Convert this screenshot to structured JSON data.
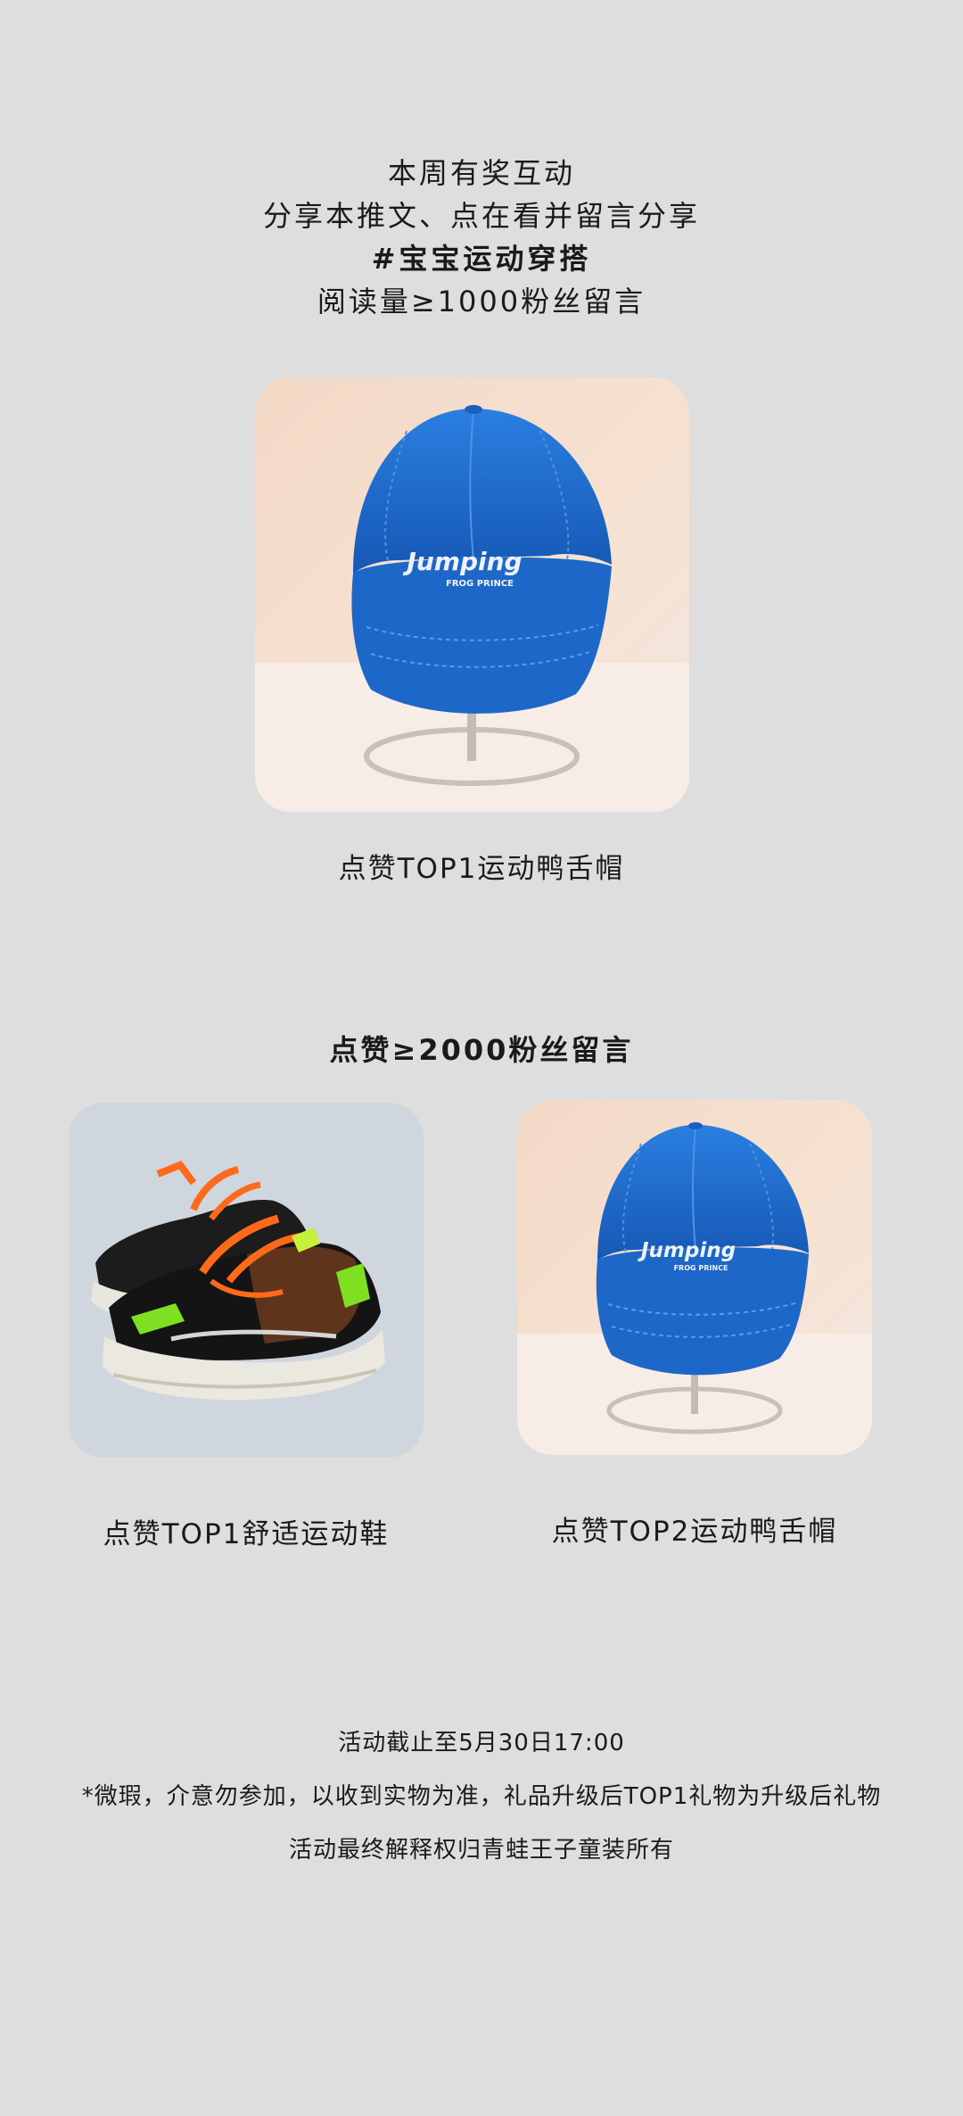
{
  "intro": {
    "line1": "本周有奖互动",
    "line2": "分享本推文、点在看并留言分享",
    "line3": "#宝宝运动穿搭",
    "line4": "阅读量≥1000粉丝留言"
  },
  "tier1": {
    "prize_caption": "点赞TOP1运动鸭舌帽",
    "cap_brand": "Jumping",
    "cap_sub": "FROG PRINCE"
  },
  "tier2": {
    "title": "点赞≥2000粉丝留言",
    "left_caption": "点赞TOP1舒适运动鞋",
    "right_caption": "点赞TOP2运动鸭舌帽",
    "cap_brand": "Jumping",
    "cap_sub": "FROG PRINCE"
  },
  "footer": {
    "deadline": "活动截止至5月30日17:00",
    "note": "*微瑕，介意勿参加，以收到实物为准，礼品升级后TOP1礼物为升级后礼物",
    "rights": "活动最终解释权归青蛙王子童装所有"
  },
  "colors": {
    "background": "#dedede",
    "cap_blue": "#1f6fd0",
    "shoe_orange": "#ff6a1a",
    "shoe_green": "#7ee020"
  }
}
